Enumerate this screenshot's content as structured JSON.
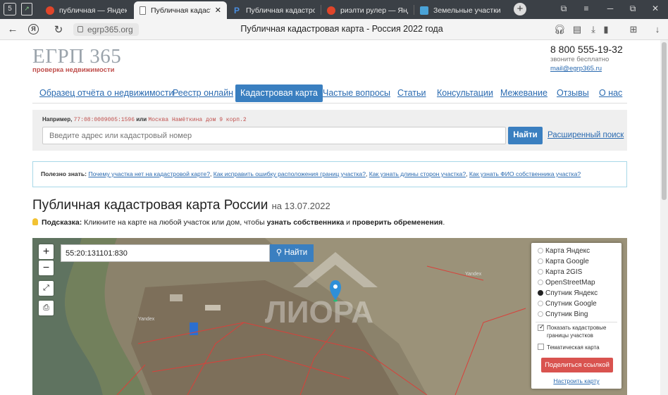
{
  "browser": {
    "tabs": [
      {
        "label": "публичная — Яндекс",
        "icon": "yandex-icon",
        "active": false
      },
      {
        "label": "Публичная кадастро",
        "icon": "document-icon",
        "active": true
      },
      {
        "label": "Публичная кадастров",
        "icon": "p-icon",
        "active": false
      },
      {
        "label": "риэлти рулер — Янде",
        "icon": "yandex-icon",
        "active": false
      },
      {
        "label": "Земельные участки - E",
        "icon": "ya-icon",
        "active": false
      }
    ],
    "new_tab_label": "+",
    "url": "egrp365.org",
    "page_title": "Публичная кадастровая карта - Россия 2022 года",
    "window_buttons": [
      "⧉",
      "≡",
      "─",
      "⧉",
      "✕"
    ]
  },
  "site": {
    "logo": "ЕГРП 365",
    "tagline": "проверка недвижимости",
    "phone": "8 800 555-19-32",
    "phone_sub": "звоните бесплатно",
    "email": "mail@egrp365.ru"
  },
  "nav": [
    {
      "label": "Образец отчёта о недвижимости",
      "active": false
    },
    {
      "label": "Реестр онлайн",
      "active": false
    },
    {
      "label": "Кадастровая карта",
      "active": true
    },
    {
      "label": "Частые вопросы",
      "active": false
    },
    {
      "label": "Статьи",
      "active": false
    },
    {
      "label": "Консультации",
      "active": false
    },
    {
      "label": "Межевание",
      "active": false
    },
    {
      "label": "Отзывы",
      "active": false
    },
    {
      "label": "О нас",
      "active": false
    }
  ],
  "search": {
    "example_prefix": "Например,",
    "example_code": "77:08:0009005:1596",
    "example_or": "или",
    "example_address": "Москва Намёткина дом 9 корп.2",
    "placeholder": "Введите адрес или кадастровый номер",
    "find_label": "Найти",
    "advanced_label": "Расширенный поиск"
  },
  "useful": {
    "label": "Полезно знать:",
    "links": [
      "Почему участка нет на кадастровой карте?",
      "Как исправить ошибку расположения границ участка?",
      "Как узнать длины сторон участка?",
      "Как узнать ФИО собственника участка?"
    ]
  },
  "heading": {
    "title": "Публичная кадастровая карта России",
    "date": "на 13.07.2022"
  },
  "hint": {
    "label": "Подсказка:",
    "text1": "Кликните на карте на любой участок или дом, чтобы ",
    "bold1": "узнать собственника",
    "text2": " и ",
    "bold2": "проверить обременения",
    "text3": "."
  },
  "map": {
    "query": "55:20:131101:830",
    "find_label": "Найти",
    "zoom_in": "+",
    "zoom_out": "−",
    "watermark": "ЛИОРА",
    "place_labels": [
      "Yandex",
      "Yandex"
    ],
    "layers": [
      {
        "label": "Карта Яндекс",
        "selected": false
      },
      {
        "label": "Карта Google",
        "selected": false
      },
      {
        "label": "Карта 2GIS",
        "selected": false
      },
      {
        "label": "OpenStreetMap",
        "selected": false
      },
      {
        "label": "Спутник Яндекс",
        "selected": true
      },
      {
        "label": "Спутник Google",
        "selected": false
      },
      {
        "label": "Спутник Bing",
        "selected": false
      }
    ],
    "show_borders_label": "Показать кадастровые границы участков",
    "show_borders_checked": true,
    "thematic_label": "Тематическая карта",
    "thematic_checked": false,
    "share_label": "Поделиться ссылкой",
    "configure_label": "Настроить карту"
  },
  "colors": {
    "accent": "#3a7fc0",
    "link": "#2a6ab0",
    "brand_red": "#c0504d",
    "share": "#d9534f"
  }
}
